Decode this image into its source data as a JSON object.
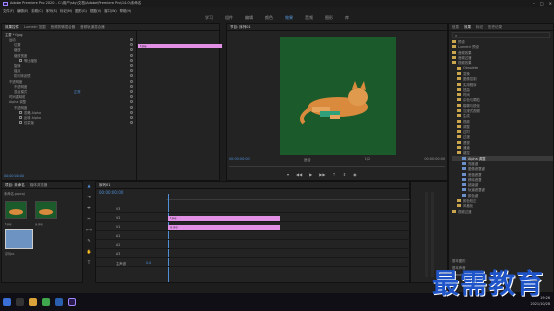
{
  "window": {
    "title": "Adobe Premiere Pro 2020 - C:\\用户\\sky\\文档\\Adobe\\Premiere Pro\\14.0\\未命名"
  },
  "menu": [
    "文件(F)",
    "编辑(E)",
    "剪辑(C)",
    "序列(S)",
    "标记(M)",
    "图形(G)",
    "视图(V)",
    "窗口(W)",
    "帮助(H)"
  ],
  "workspaces": [
    "学习",
    "组件",
    "编辑",
    "颜色",
    "效果",
    "音频",
    "图形",
    "库"
  ],
  "active_workspace": "效果",
  "effect_controls": {
    "tabs": [
      "效果控件",
      "Lumetri 范围",
      "音频剪辑混合器",
      "音频轨道混合器"
    ],
    "source": "主要 * f.jpg",
    "clip_label": "f.jpg",
    "rows": [
      {
        "label": "运动",
        "indent": 1
      },
      {
        "label": "位置",
        "indent": 2,
        "value": ""
      },
      {
        "label": "缩放",
        "indent": 2,
        "value": ""
      },
      {
        "label": "缩放宽度",
        "indent": 2,
        "value": ""
      },
      {
        "label": "等比缩放",
        "indent": 3,
        "check": true
      },
      {
        "label": "旋转",
        "indent": 2,
        "value": ""
      },
      {
        "label": "锚点",
        "indent": 2,
        "value": ""
      },
      {
        "label": "防闪烁滤镜",
        "indent": 2,
        "value": ""
      },
      {
        "label": "不透明度",
        "indent": 1
      },
      {
        "label": "不透明度",
        "indent": 2,
        "value": ""
      },
      {
        "label": "混合模式",
        "indent": 2,
        "value": "正常"
      },
      {
        "label": "时间重映射",
        "indent": 1
      },
      {
        "label": "Alpha 调整",
        "indent": 1
      },
      {
        "label": "不透明度",
        "indent": 2,
        "value": ""
      },
      {
        "label": "忽略 Alpha",
        "indent": 3,
        "check": true
      },
      {
        "label": "反转 Alpha",
        "indent": 3,
        "check": true
      },
      {
        "label": "仅蒙版",
        "indent": 3,
        "check": true
      }
    ]
  },
  "program": {
    "tab": "节目: 序列01",
    "timecode_left": "00:00:00:00",
    "fit": "适合",
    "quality": "1/2",
    "timecode_right": "00:00:00:00"
  },
  "project": {
    "tabs": [
      "项目: 未命名",
      "媒体浏览器"
    ],
    "path": "未命名.prproj",
    "items": [
      "f.jpg",
      "g.jpg",
      "序列01"
    ]
  },
  "timeline": {
    "tab": "序列01",
    "timecode": "00:00:00:00",
    "tracks": [
      "V3",
      "V2",
      "V1",
      "A1",
      "A2",
      "A3",
      "主声道"
    ],
    "clips": [
      {
        "track": "V2",
        "label": "f.jpg"
      },
      {
        "track": "V1",
        "label": "g.jpg"
      }
    ],
    "master_value": "0.0"
  },
  "effects_panel": {
    "tabs": [
      "信息",
      "效果",
      "标记",
      "历史记录"
    ],
    "tree": [
      {
        "label": "预设",
        "indent": 0
      },
      {
        "label": "Lumetri 预设",
        "indent": 0
      },
      {
        "label": "音频效果",
        "indent": 0
      },
      {
        "label": "音频过渡",
        "indent": 0
      },
      {
        "label": "视频效果",
        "indent": 0
      },
      {
        "label": "Obsolete",
        "indent": 1
      },
      {
        "label": "变换",
        "indent": 1
      },
      {
        "label": "图像控制",
        "indent": 1
      },
      {
        "label": "实用程序",
        "indent": 1
      },
      {
        "label": "扭曲",
        "indent": 1
      },
      {
        "label": "时间",
        "indent": 1
      },
      {
        "label": "杂色与颗粒",
        "indent": 1
      },
      {
        "label": "模糊与锐化",
        "indent": 1
      },
      {
        "label": "沉浸式视频",
        "indent": 1
      },
      {
        "label": "生成",
        "indent": 1
      },
      {
        "label": "视频",
        "indent": 1
      },
      {
        "label": "调整",
        "indent": 1
      },
      {
        "label": "过时",
        "indent": 1
      },
      {
        "label": "过渡",
        "indent": 1
      },
      {
        "label": "透视",
        "indent": 1
      },
      {
        "label": "通道",
        "indent": 1
      },
      {
        "label": "键控",
        "indent": 1
      },
      {
        "label": "Alpha 调整",
        "indent": 2,
        "selected": true
      },
      {
        "label": "亮度键",
        "indent": 2
      },
      {
        "label": "图像遮罩键",
        "indent": 2
      },
      {
        "label": "差值遮罩",
        "indent": 2
      },
      {
        "label": "移除遮罩",
        "indent": 2
      },
      {
        "label": "超级键",
        "indent": 2
      },
      {
        "label": "轨道遮罩键",
        "indent": 2
      },
      {
        "label": "颜色键",
        "indent": 2
      },
      {
        "label": "颜色校正",
        "indent": 1
      },
      {
        "label": "风格化",
        "indent": 1
      },
      {
        "label": "视频过渡",
        "indent": 0
      }
    ],
    "bottom": [
      "基本图形",
      "基本声音",
      "Lumetri 颜色",
      "库"
    ]
  },
  "taskbar": {
    "time": "19:26",
    "date": "2021/10/28"
  },
  "watermark": "最需教育"
}
